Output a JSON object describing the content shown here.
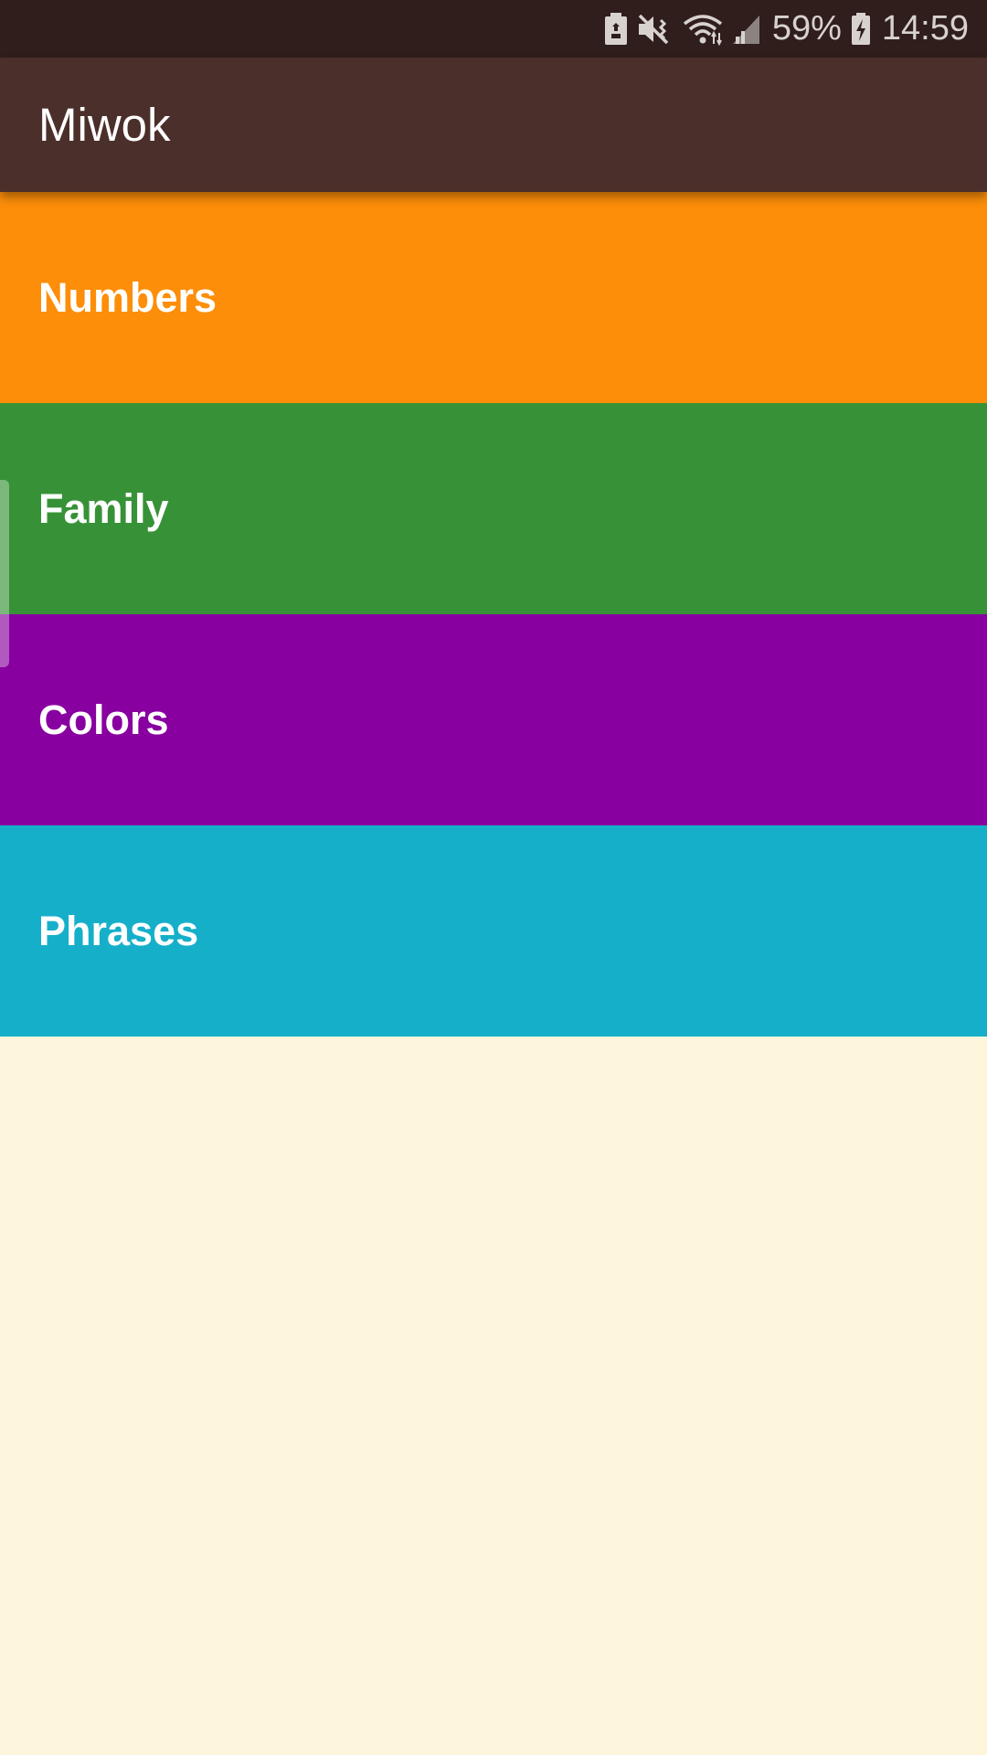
{
  "status_bar": {
    "battery_percent": "59%",
    "time": "14:59",
    "icons": [
      "battery-saver-icon",
      "mute-icon",
      "wifi-icon",
      "signal-icon",
      "battery-charging-icon"
    ]
  },
  "app_bar": {
    "title": "Miwok"
  },
  "categories": [
    {
      "label": "Numbers",
      "color": "#FD8E09"
    },
    {
      "label": "Family",
      "color": "#379237"
    },
    {
      "label": "Colors",
      "color": "#8800A0"
    },
    {
      "label": "Phrases",
      "color": "#16AFCA"
    }
  ],
  "colors": {
    "status_bar": "#2F1E1C",
    "app_bar": "#4B2F2A",
    "background": "#FEF6DC"
  }
}
